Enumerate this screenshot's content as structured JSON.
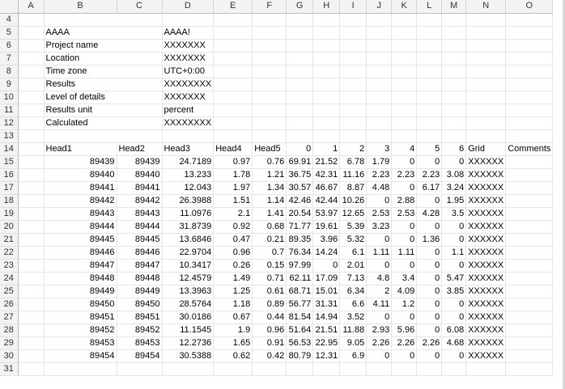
{
  "columns": [
    "A",
    "B",
    "C",
    "D",
    "E",
    "F",
    "G",
    "H",
    "I",
    "J",
    "K",
    "L",
    "M",
    "N",
    "O"
  ],
  "info": [
    {
      "row": "4",
      "label": "",
      "value": ""
    },
    {
      "row": "5",
      "label": "AAAA",
      "value": "AAAA!"
    },
    {
      "row": "6",
      "label": "Project name",
      "value": "XXXXXXX"
    },
    {
      "row": "7",
      "label": "Location",
      "value": "XXXXXXX"
    },
    {
      "row": "8",
      "label": "Time zone",
      "value": "UTC+0:00"
    },
    {
      "row": "9",
      "label": "Results",
      "value": "XXXXXXXX"
    },
    {
      "row": "10",
      "label": "Level of details",
      "value": "XXXXXXX"
    },
    {
      "row": "11",
      "label": "Results unit",
      "value": "percent"
    },
    {
      "row": "12",
      "label": "Calculated",
      "value": "XXXXXXXX"
    },
    {
      "row": "13",
      "label": "",
      "value": ""
    }
  ],
  "header_row": {
    "row": "14",
    "cells": [
      "",
      "Head1",
      "Head2",
      "Head3",
      "Head4",
      "Head5",
      "0",
      "1",
      "2",
      "3",
      "4",
      "5",
      "6",
      "Grid",
      "Comments"
    ]
  },
  "data_rows": [
    {
      "row": "15",
      "cells": [
        "",
        "89439",
        "89439",
        "24.7189",
        "0.97",
        "0.76",
        "69.91",
        "21.52",
        "6.78",
        "1.79",
        "0",
        "0",
        "0",
        "XXXXXX",
        ""
      ]
    },
    {
      "row": "16",
      "cells": [
        "",
        "89440",
        "89440",
        "13.233",
        "1.78",
        "1.21",
        "36.75",
        "42.31",
        "11.16",
        "2.23",
        "2.23",
        "2.23",
        "3.08",
        "XXXXXX",
        ""
      ]
    },
    {
      "row": "17",
      "cells": [
        "",
        "89441",
        "89441",
        "12.043",
        "1.97",
        "1.34",
        "30.57",
        "46.67",
        "8.87",
        "4.48",
        "0",
        "6.17",
        "3.24",
        "XXXXXX",
        ""
      ]
    },
    {
      "row": "18",
      "cells": [
        "",
        "89442",
        "89442",
        "26.3988",
        "1.51",
        "1.14",
        "42.46",
        "42.44",
        "10.26",
        "0",
        "2.88",
        "0",
        "1.95",
        "XXXXXX",
        ""
      ]
    },
    {
      "row": "19",
      "cells": [
        "",
        "89443",
        "89443",
        "11.0976",
        "2.1",
        "1.41",
        "20.54",
        "53.97",
        "12.65",
        "2.53",
        "2.53",
        "4.28",
        "3.5",
        "XXXXXX",
        ""
      ]
    },
    {
      "row": "20",
      "cells": [
        "",
        "89444",
        "89444",
        "31.8739",
        "0.92",
        "0.68",
        "71.77",
        "19.61",
        "5.39",
        "3.23",
        "0",
        "0",
        "0",
        "XXXXXX",
        ""
      ]
    },
    {
      "row": "21",
      "cells": [
        "",
        "89445",
        "89445",
        "13.6846",
        "0.47",
        "0.21",
        "89.35",
        "3.96",
        "5.32",
        "0",
        "0",
        "1.36",
        "0",
        "XXXXXX",
        ""
      ]
    },
    {
      "row": "22",
      "cells": [
        "",
        "89446",
        "89446",
        "22.9704",
        "0.96",
        "0.7",
        "76.34",
        "14.24",
        "6.1",
        "1.11",
        "1.11",
        "0",
        "1.1",
        "XXXXXX",
        ""
      ]
    },
    {
      "row": "23",
      "cells": [
        "",
        "89447",
        "89447",
        "10.3417",
        "0.26",
        "0.15",
        "97.99",
        "0",
        "2.01",
        "0",
        "0",
        "0",
        "0",
        "XXXXXX",
        ""
      ]
    },
    {
      "row": "24",
      "cells": [
        "",
        "89448",
        "89448",
        "12.4579",
        "1.49",
        "0.71",
        "62.11",
        "17.09",
        "7.13",
        "4.8",
        "3.4",
        "0",
        "5.47",
        "XXXXXX",
        ""
      ]
    },
    {
      "row": "25",
      "cells": [
        "",
        "89449",
        "89449",
        "13.3963",
        "1.25",
        "0.61",
        "68.71",
        "15.01",
        "6.34",
        "2",
        "4.09",
        "0",
        "3.85",
        "XXXXXX",
        ""
      ]
    },
    {
      "row": "26",
      "cells": [
        "",
        "89450",
        "89450",
        "28.5764",
        "1.18",
        "0.89",
        "56.77",
        "31.31",
        "6.6",
        "4.11",
        "1.2",
        "0",
        "0",
        "XXXXXX",
        ""
      ]
    },
    {
      "row": "27",
      "cells": [
        "",
        "89451",
        "89451",
        "30.0186",
        "0.67",
        "0.44",
        "81.54",
        "14.94",
        "3.52",
        "0",
        "0",
        "0",
        "0",
        "XXXXXX",
        ""
      ]
    },
    {
      "row": "28",
      "cells": [
        "",
        "89452",
        "89452",
        "11.1545",
        "1.9",
        "0.96",
        "51.64",
        "21.51",
        "11.88",
        "2.93",
        "5.96",
        "0",
        "6.08",
        "XXXXXX",
        ""
      ]
    },
    {
      "row": "29",
      "cells": [
        "",
        "89453",
        "89453",
        "12.2736",
        "1.65",
        "0.91",
        "56.53",
        "22.95",
        "9.05",
        "2.26",
        "2.26",
        "2.26",
        "4.68",
        "XXXXXX",
        ""
      ]
    },
    {
      "row": "30",
      "cells": [
        "",
        "89454",
        "89454",
        "30.5388",
        "0.62",
        "0.42",
        "80.79",
        "12.31",
        "6.9",
        "0",
        "0",
        "0",
        "0",
        "XXXXXX",
        ""
      ]
    },
    {
      "row": "31",
      "cells": [
        "",
        "",
        "",
        "",
        "",
        "",
        "",
        "",
        "",
        "",
        "",
        "",
        "",
        "",
        ""
      ]
    }
  ]
}
